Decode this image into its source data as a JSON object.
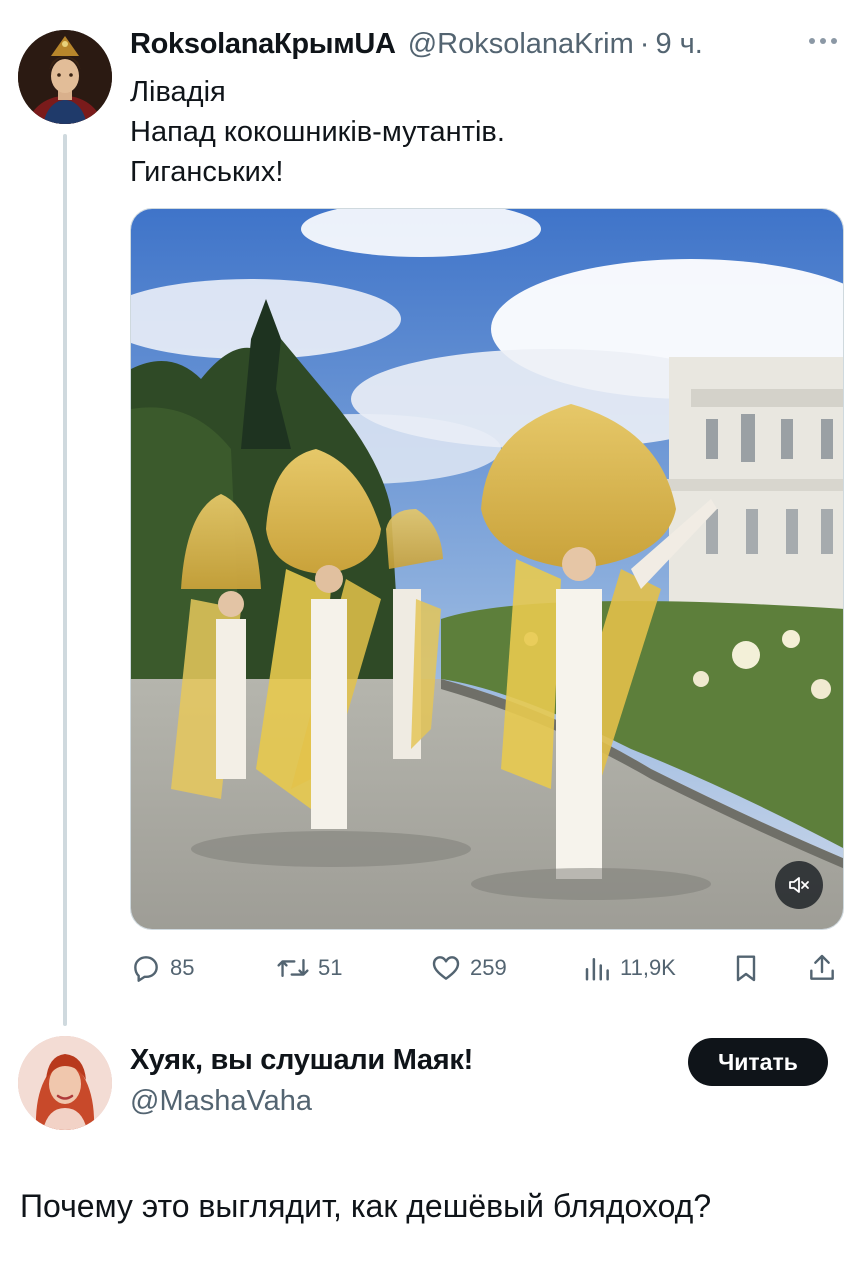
{
  "tweet": {
    "display_name": "RoksolanaКрымUA",
    "handle": "@RoksolanaKrim",
    "separator": "·",
    "time": "9 ч.",
    "lines": [
      "Лівадія",
      "Напад кокошників-мутантів.",
      "Гиганських!"
    ],
    "stats": {
      "replies": "85",
      "retweets": "51",
      "likes": "259",
      "views": "11,9K"
    }
  },
  "author_card": {
    "display_name": "Хуяк, вы слушали Маяк!",
    "handle": "@MashaVaha",
    "follow_label": "Читать"
  },
  "post_text": "Почему это выглядит, как дешёвый блядоход?",
  "icons": {
    "more": "more-icon",
    "reply": "reply-icon",
    "retweet": "retweet-icon",
    "like": "heart-icon",
    "views": "views-icon",
    "bookmark": "bookmark-icon",
    "share": "share-icon",
    "mute": "mute-icon"
  },
  "colors": {
    "text_primary": "#0f1419",
    "text_secondary": "#536471",
    "thread_line": "#cfd9de",
    "button_bg": "#0f1419"
  }
}
